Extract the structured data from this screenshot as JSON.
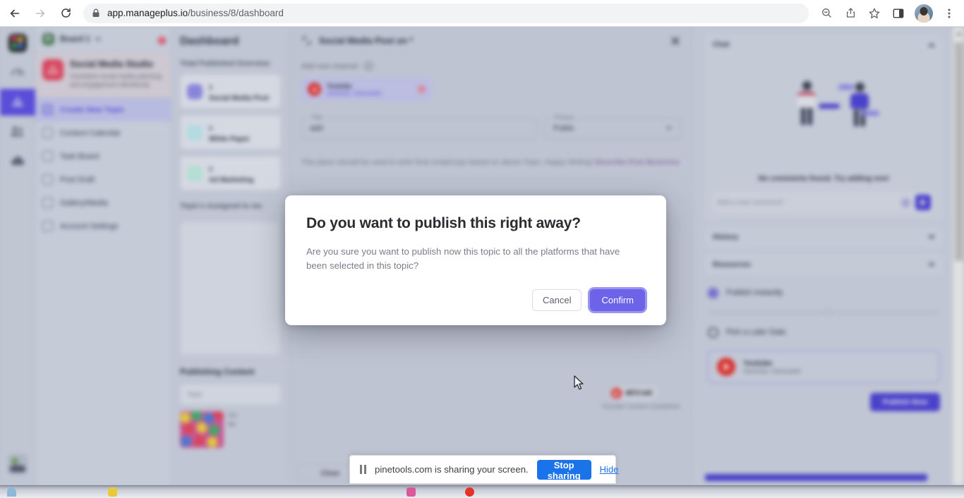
{
  "browser": {
    "url_host": "app.manageplus.io",
    "url_path": "/business/8/dashboard",
    "back_icon": "back-arrow-icon",
    "forward_icon": "forward-arrow-icon",
    "reload_icon": "reload-icon",
    "lock_icon": "lock-icon",
    "zoom_out_icon": "zoom-out-icon",
    "share_icon": "share-icon",
    "bookmark_icon": "star-icon",
    "side_panel_icon": "side-panel-icon",
    "menu_icon": "three-dot-menu-icon"
  },
  "icon_rail": {
    "items": [
      {
        "name": "app-logo",
        "label": ""
      },
      {
        "name": "dashboard-gauge-icon",
        "label": ""
      },
      {
        "name": "social-media-studio-icon",
        "label": "",
        "active": true
      },
      {
        "name": "team-icon",
        "label": ""
      },
      {
        "name": "cloud-icon",
        "label": ""
      }
    ]
  },
  "sidebar": {
    "board_name": "Board 1",
    "board_initial": "B",
    "notification_count": "2",
    "studio_title": "Social Media Studio",
    "studio_subtitle": "Centralize social media planning and engagement effortlessly",
    "items": [
      {
        "label": "Create New Topic",
        "active": true
      },
      {
        "label": "Content Calendar",
        "active": false
      },
      {
        "label": "Task Board",
        "active": false
      },
      {
        "label": "Post Draft",
        "active": false
      },
      {
        "label": "Gallery/Media",
        "active": false
      },
      {
        "label": "Account Settings",
        "active": false
      }
    ]
  },
  "dashboard": {
    "title": "Dashboard",
    "overview_label": "Total Published Overview",
    "stats": [
      {
        "count": "0",
        "label": "Social Media Post",
        "color": "#8f8ae8"
      },
      {
        "count": "0",
        "label": "White Paper",
        "color": "#7fd4e0"
      },
      {
        "count": "0",
        "label": "Ad Marketing",
        "color": "#6fd6b0"
      }
    ],
    "assigned_label": "Topic's Assigned to me",
    "publishing_content_label": "Publishing Content",
    "topic_placeholder": "Topic",
    "thumb_meta_line1": "Soc",
    "thumb_meta_line2": "Me"
  },
  "editor": {
    "title": "Social Media Post on *",
    "expand_icon": "expand-icon",
    "close_icon": "close-icon",
    "add_channel_label": "Add new channel",
    "channel": {
      "name": "Youtube",
      "sub": "General, Carousels"
    },
    "title_field": {
      "label": "Title",
      "value": "add"
    },
    "privacy_field": {
      "label": "Privacy",
      "value": "Public"
    },
    "hint_text": "This place should be used to write final script/copy based on above Topic. Happy Writing!",
    "hint_bold": "Describe Post Business",
    "char_count": "4973 left",
    "guidelines_text": "Youtube Content Guidelines",
    "close_button": "Close"
  },
  "right_panel": {
    "chat": {
      "title": "Chat",
      "empty_text": "No comments found. Try adding one!",
      "comment_placeholder": "Add a new comment!",
      "emoji_icon": "emoji-icon",
      "send_icon": "send-icon"
    },
    "history_title": "History",
    "resources_title": "Resources",
    "schedule": {
      "publish_instantly": "Publish Instantly",
      "pick_later": "Pick a Later Date",
      "selected": "Publish Instantly"
    },
    "channel_card": {
      "name": "Youtube",
      "sub": "General, Carousels"
    },
    "publish_button": "Publish Now"
  },
  "modal": {
    "title": "Do you want to publish this right away?",
    "body": "Are you sure you want to publish now this topic to all the platforms that have been selected in this topic?",
    "cancel_label": "Cancel",
    "confirm_label": "Confirm",
    "confirm_color": "#6c63e8"
  },
  "share_bar": {
    "pause_icon": "pause-icon",
    "message": "pinetools.com is sharing your screen.",
    "stop_label": "Stop sharing",
    "hide_label": "Hide",
    "accent_color": "#1a73e8"
  }
}
